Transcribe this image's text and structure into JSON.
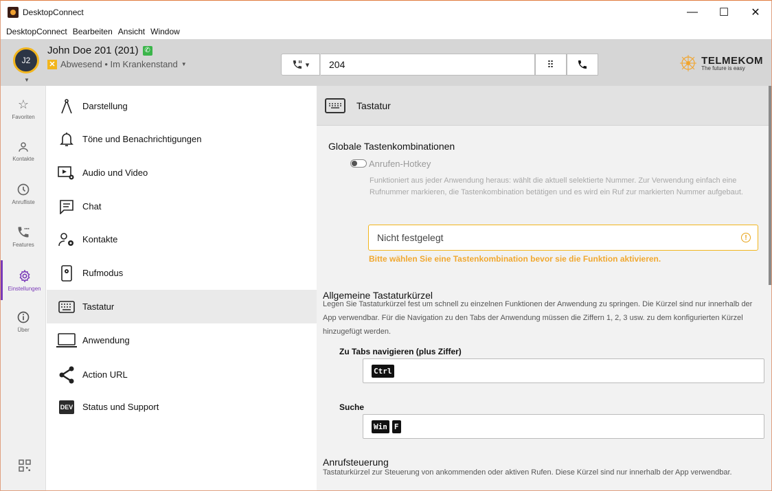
{
  "window": {
    "title": "DesktopConnect",
    "controls": [
      "—",
      "☐",
      "✕"
    ]
  },
  "menu": [
    "DesktopConnect",
    "Bearbeiten",
    "Ansicht",
    "Window"
  ],
  "user": {
    "initials": "J2",
    "name": "John Doe 201 (201)",
    "status": "Abwesend • Im Krankenstand",
    "status_color": "#f2b51c"
  },
  "dial": {
    "value": "204"
  },
  "brand": {
    "name": "TELMEKOM",
    "tagline": "The future is easy"
  },
  "rail": [
    {
      "label": "Favoriten",
      "icon": "star-icon"
    },
    {
      "label": "Kontakte",
      "icon": "person-icon"
    },
    {
      "label": "Anrufliste",
      "icon": "clock-icon"
    },
    {
      "label": "Features",
      "icon": "phone-features-icon"
    },
    {
      "label": "Einstellungen",
      "icon": "gear-icon",
      "active": true
    },
    {
      "label": "Über",
      "icon": "info-icon"
    }
  ],
  "settings_nav": [
    {
      "label": "Darstellung",
      "icon": "compass-icon"
    },
    {
      "label": "Töne und Benachrichtigungen",
      "icon": "bell-icon"
    },
    {
      "label": "Audio und Video",
      "icon": "audio-video-settings-icon"
    },
    {
      "label": "Chat",
      "icon": "chat-icon"
    },
    {
      "label": "Kontakte",
      "icon": "contacts-settings-icon"
    },
    {
      "label": "Rufmodus",
      "icon": "phone-mode-icon"
    },
    {
      "label": "Tastatur",
      "icon": "keyboard-icon",
      "active": true
    },
    {
      "label": "Anwendung",
      "icon": "laptop-icon"
    },
    {
      "label": "Action URL",
      "icon": "share-icon"
    },
    {
      "label": "Status und Support",
      "icon": "dev-icon",
      "badge": "DEV"
    }
  ],
  "main": {
    "title": "Tastatur",
    "global": {
      "heading": "Globale Tastenkombinationen",
      "toggle_label": "Anrufen-Hotkey",
      "toggle_on": false,
      "description": "Funktioniert aus jeder Anwendung heraus: wählt die aktuell selektierte Nummer. Zur Verwendung einfach eine Rufnummer markieren, die Tastenkombination betätigen und es wird ein Ruf zur markierten Nummer aufgebaut.",
      "hotkey_placeholder": "Nicht festgelegt",
      "warning": "Bitte wählen Sie eine Tastenkombination bevor sie die Funktion aktivieren."
    },
    "general": {
      "heading": "Allgemeine Tastaturkürzel",
      "description": "Legen Sie Tastaturkürzel fest um schnell zu einzelnen Funktionen der Anwendung zu springen. Die Kürzel sind nur innerhalb der App verwendbar. Für die Navigation zu den Tabs der Anwendung müssen die Ziffern 1, 2, 3 usw. zu dem konfigurierten Kürzel hinzugefügt werden.",
      "tabs_label": "Zu Tabs navigieren (plus Ziffer)",
      "tabs_keys": [
        "Ctrl"
      ],
      "search_label": "Suche",
      "search_keys": [
        "Win",
        "F"
      ]
    },
    "call": {
      "heading": "Anrufsteuerung",
      "description": "Tastaturkürzel zur Steuerung von ankommenden oder aktiven Rufen. Diese Kürzel sind nur innerhalb der App verwendbar."
    }
  }
}
